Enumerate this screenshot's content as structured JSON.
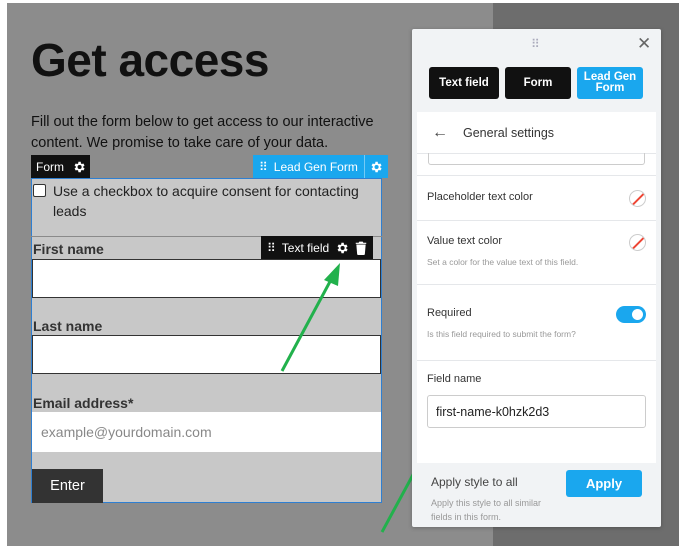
{
  "page": {
    "title": "Get access",
    "intro": "Fill out the form below to get access to our interactive content. We promise to take care of your data."
  },
  "tags": {
    "form": "Form",
    "lead_gen_form": "Lead Gen Form",
    "text_field": "Text field"
  },
  "form": {
    "consent_text": "Use a checkbox to acquire consent for contacting leads",
    "consent_checked": false,
    "fields": [
      {
        "label": "First name",
        "placeholder": ""
      },
      {
        "label": "Last name",
        "placeholder": ""
      },
      {
        "label": "Email address*",
        "placeholder": "example@yourdomain.com"
      }
    ],
    "submit_label": "Enter"
  },
  "panel": {
    "breadcrumbs": [
      "Text field",
      "Form",
      "Lead Gen Form"
    ],
    "section_title": "General settings",
    "placeholder_color_label": "Placeholder text color",
    "value_color_label": "Value text color",
    "value_color_help": "Set a color for the value text of this field.",
    "required_label": "Required",
    "required_help": "Is this field required to submit the form?",
    "required_on": true,
    "field_name_label": "Field name",
    "field_name_value": "first-name-k0hzk2d3",
    "apply_title": "Apply style to all",
    "apply_help": "Apply this style to all similar fields in this form.",
    "apply_label": "Apply"
  },
  "colors": {
    "accent": "#1aa7ee",
    "annotation_arrow": "#22b14c",
    "dark": "#111111"
  }
}
